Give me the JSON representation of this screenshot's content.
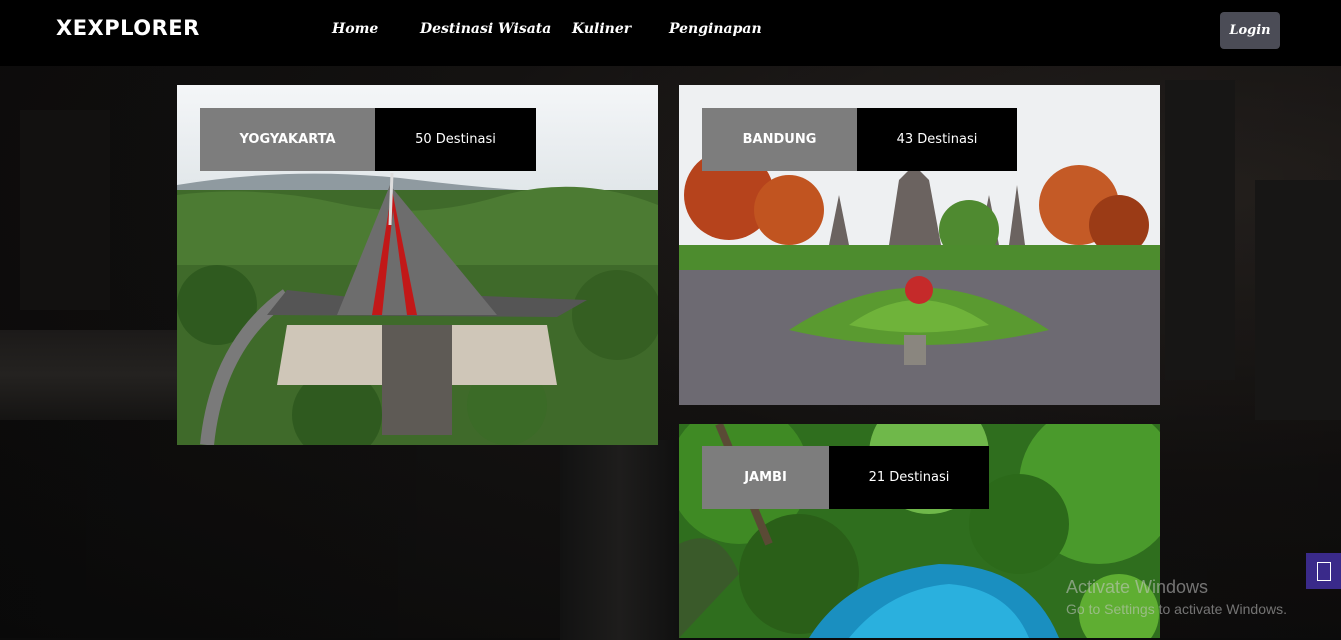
{
  "brand": "XEXPLORER",
  "nav": {
    "home": "Home",
    "destinasi": "Destinasi Wisata",
    "kuliner": "Kuliner",
    "penginapan": "Penginapan",
    "login": "Login"
  },
  "cards": [
    {
      "city": "YOGYAKARTA",
      "count": "50 Destinasi"
    },
    {
      "city": "BANDUNG",
      "count": "43 Destinasi"
    },
    {
      "city": "JAMBI",
      "count": "21 Destinasi"
    }
  ],
  "watermark": {
    "title": "Activate Windows",
    "subtitle": "Go to Settings to activate Windows."
  },
  "colors": {
    "navbar": "#000000",
    "label_city": "#7d7d7d",
    "label_count": "#000000",
    "login_button": "#4b4c56"
  }
}
